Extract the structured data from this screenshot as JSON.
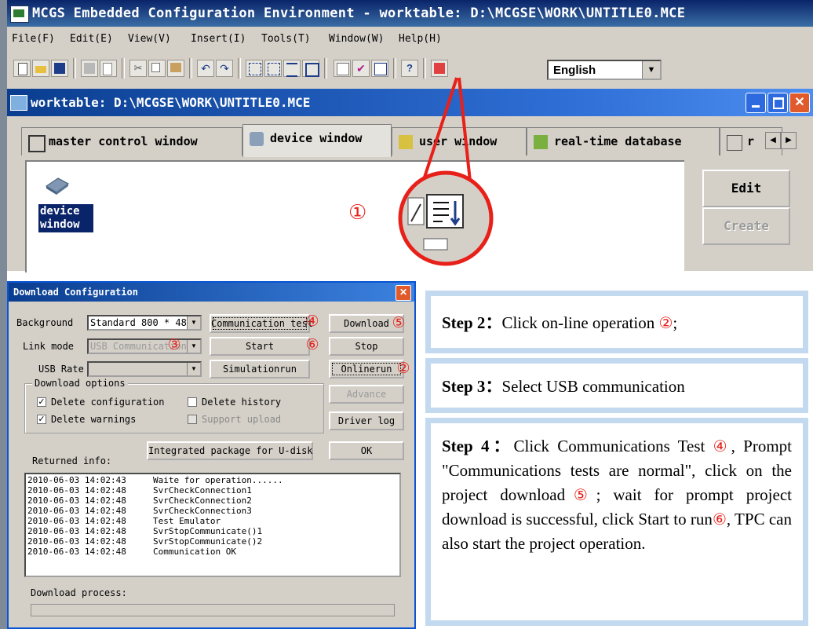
{
  "app": {
    "title": "MCGS Embedded Configuration Environment - worktable: D:\\MCGSE\\WORK\\UNTITLE0.MCE",
    "menu": [
      "File(F)",
      "Edit(E)",
      "View(V)",
      "Insert(I)",
      "Tools(T)",
      "Window(W)",
      "Help(H)"
    ],
    "language": "English"
  },
  "child": {
    "title": "worktable: D:\\MCGSE\\WORK\\UNTITLE0.MCE",
    "close_glyph": "✕",
    "tabs": [
      "master control window",
      "device window",
      "user window",
      "real-time database",
      "r"
    ],
    "device_label": "device window",
    "edit_label": "Edit",
    "create_label": "Create"
  },
  "annotation": {
    "marker1": "①"
  },
  "dialog": {
    "title": "Download Configuration",
    "close_glyph": "✕",
    "background_label": "Background",
    "background_value": "Standard 800 * 480",
    "link_mode_label": "Link mode",
    "link_mode_value": "USB Communication",
    "usb_rate_label": "USB Rate",
    "usb_rate_value": "",
    "download_options_label": "Download options",
    "options": {
      "delete_configuration": "Delete configuration",
      "delete_history": "Delete history",
      "delete_warnings": "Delete warnings",
      "support_upload": "Support upload"
    },
    "buttons": {
      "communication_test": "Communication test",
      "download": "Download",
      "start": "Start",
      "stop": "Stop",
      "simulationrun": "Simulationrun",
      "onlinerun": "Onlinerun",
      "advance": "Advance",
      "driver_log": "Driver log",
      "integrated_package": "Integrated package for U-disk",
      "ok": "OK"
    },
    "returned_info_label": "Returned info:",
    "log": [
      {
        "time": "2010-06-03 14:02:43",
        "msg": "Waite for operation......"
      },
      {
        "time": "2010-06-03 14:02:48",
        "msg": "SvrCheckConnection1"
      },
      {
        "time": "2010-06-03 14:02:48",
        "msg": "SvrCheckConnection2"
      },
      {
        "time": "2010-06-03 14:02:48",
        "msg": "SvrCheckConnection3"
      },
      {
        "time": "2010-06-03 14:02:48",
        "msg": "Test Emulator"
      },
      {
        "time": "2010-06-03 14:02:48",
        "msg": "SvrStopCommunicate()1"
      },
      {
        "time": "2010-06-03 14:02:48",
        "msg": "SvrStopCommunicate()2"
      },
      {
        "time": "2010-06-03 14:02:48",
        "msg": "Communication OK"
      }
    ],
    "download_process_label": "Download process:",
    "markers": {
      "m2": "②",
      "m3": "③",
      "m4": "④",
      "m5": "⑤",
      "m6": "⑥"
    }
  },
  "steps": {
    "step2": {
      "label": "Step 2",
      "colon": "：",
      "text": "Click on-line operation ",
      "marker": "②",
      "tail": ";"
    },
    "step3": {
      "label": "Step 3",
      "colon": "：",
      "text": "Select USB communication"
    },
    "step4": {
      "label": "Step 4",
      "colon": "：",
      "part1": "Click Communications Test ",
      "m4": "④",
      "part2": ", Prompt \"Communications tests are normal\", click on the project download",
      "m5": "⑤",
      "part3": "; wait for prompt project download is successful, click Start to run",
      "m6": "⑥",
      "part4": ", TPC can also start the project operation."
    }
  },
  "colors": {
    "accent_red": "#e8201a",
    "step_border": "#c3d9ef",
    "title_blue": "#0a246a"
  }
}
